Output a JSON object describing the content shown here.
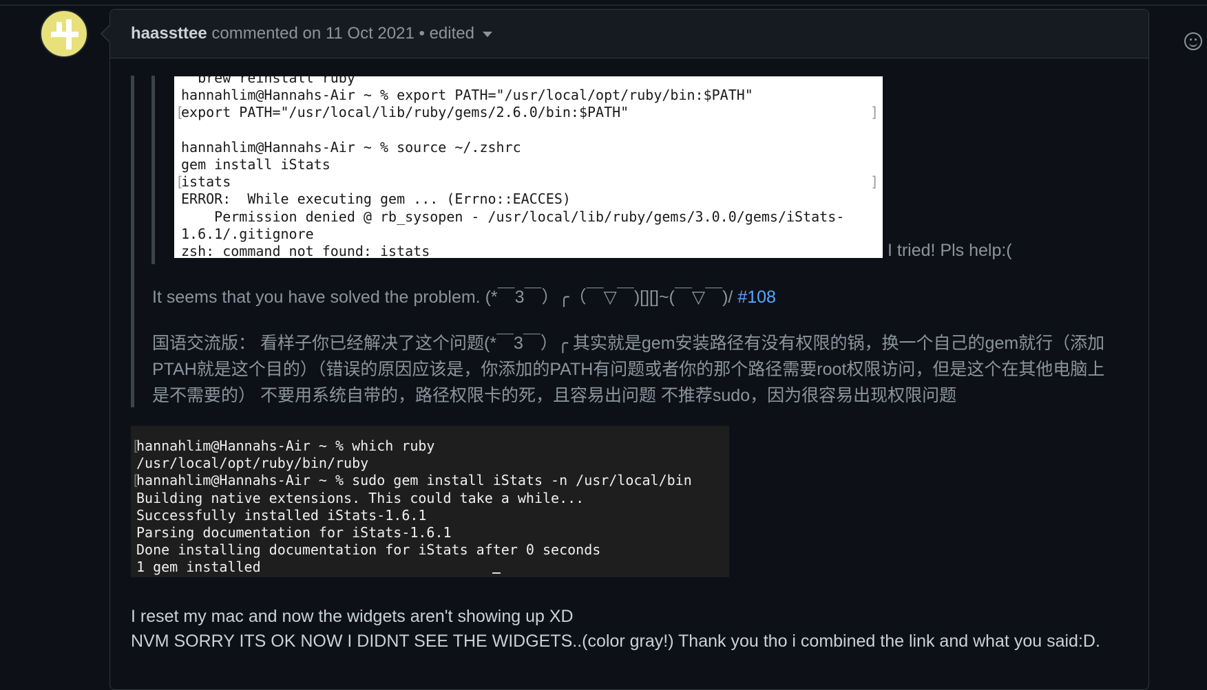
{
  "comment": {
    "author": "haassttee",
    "action": "commented on",
    "date": "11 Oct 2021",
    "separator": "•",
    "edited_label": "edited",
    "more_icon": "kebab-horizontal-icon",
    "reaction_icon": "smiley-icon"
  },
  "quote": {
    "terminal_top_lines": [
      "  brew reinstall ruby",
      "hannahlim@Hannahs-Air ~ % export PATH=\"/usr/local/opt/ruby/bin:$PATH\"",
      "export PATH=\"/usr/local/lib/ruby/gems/2.6.0/bin:$PATH\"",
      "",
      "hannahlim@Hannahs-Air ~ % source ~/.zshrc",
      "gem install iStats",
      "istats",
      "ERROR:  While executing gem ... (Errno::EACCES)",
      "    Permission denied @ rb_sysopen - /usr/local/lib/ruby/gems/3.0.0/gems/iStats-",
      "1.6.1/.gitignore",
      "zsh: command not found: istats"
    ],
    "tried_text": "I tried! Pls help:(",
    "solved_text": "It seems that you have solved the problem. (*￣3￣）╭（￣▽￣)[][]~(￣▽￣)/ ",
    "solved_link": "#108",
    "chinese_text": "国语交流版： 看样子你已经解决了这个问题(*￣3￣）╭ 其实就是gem安装路径有没有权限的锅，换一个自己的gem就行（添加PTAH就是这个目的）（错误的原因应该是，你添加的PATH有问题或者你的那个路径需要root权限访问，但是这个在其他电脑上是不需要的） 不要用系统自带的，路径权限卡的死，且容易出问题 不推荐sudo，因为很容易出现权限问题"
  },
  "terminal_dark_lines": [
    "hannahlim@Hannahs-Air ~ % which ruby",
    "/usr/local/opt/ruby/bin/ruby",
    "hannahlim@Hannahs-Air ~ % sudo gem install iStats -n /usr/local/bin",
    "Building native extensions. This could take a while...",
    "Successfully installed iStats-1.6.1",
    "Parsing documentation for iStats-1.6.1",
    "Done installing documentation for iStats after 0 seconds",
    "1 gem installed"
  ],
  "body": {
    "line1": "I reset my mac and now the widgets aren't showing up XD",
    "line2": "NVM SORRY ITS OK NOW I DIDNT SEE THE WIDGETS..(color gray!) Thank you tho i combined the link and what you said:D."
  },
  "colors": {
    "background": "#0d1117",
    "header_bg": "#161b22",
    "border": "#30363d",
    "muted_text": "#8b949e",
    "link": "#58a6ff",
    "avatar": "#e8e07a"
  }
}
